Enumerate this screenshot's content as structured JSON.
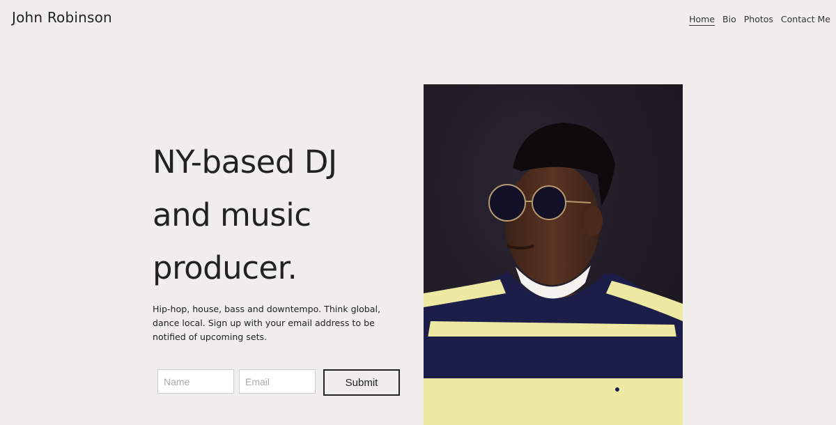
{
  "header": {
    "site_title": "John Robinson"
  },
  "nav": {
    "items": [
      "Home",
      "Bio",
      "Photos",
      "Contact Me"
    ],
    "active": "Home"
  },
  "hero": {
    "lines": [
      "NY-based DJ",
      "and music",
      "producer."
    ]
  },
  "description": "Hip-hop, house, bass and downtempo. Think global, dance local. Sign up with your email address to be notified of upcoming sets.",
  "form": {
    "name_placeholder": "Name",
    "email_placeholder": "Email",
    "submit_label": "Submit"
  },
  "colors": {
    "background": "#efeeec",
    "text": "#222222",
    "photo_background": "#1f1a24",
    "sweater_navy": "#1d1d4a",
    "sweater_yellow": "#ede9a2"
  }
}
